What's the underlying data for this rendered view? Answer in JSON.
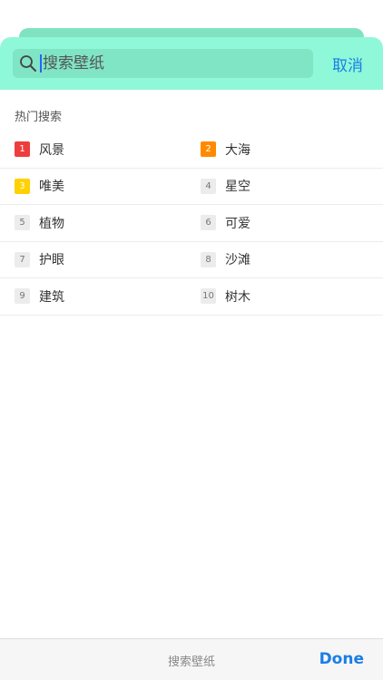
{
  "search": {
    "placeholder": "搜索壁纸",
    "cancel_label": "取消"
  },
  "hot": {
    "title": "热门搜索",
    "items": [
      {
        "rank": "1",
        "label": "风景"
      },
      {
        "rank": "2",
        "label": "大海"
      },
      {
        "rank": "3",
        "label": "唯美"
      },
      {
        "rank": "4",
        "label": "星空"
      },
      {
        "rank": "5",
        "label": "植物"
      },
      {
        "rank": "6",
        "label": "可爱"
      },
      {
        "rank": "7",
        "label": "护眼"
      },
      {
        "rank": "8",
        "label": "沙滩"
      },
      {
        "rank": "9",
        "label": "建筑"
      },
      {
        "rank": "10",
        "label": "树木"
      }
    ]
  },
  "toolbar": {
    "title": "搜索壁纸",
    "done_label": "Done"
  },
  "colors": {
    "header": "#8ff8d8",
    "accent": "#1a7ee6",
    "rank1": "#ef3d3d",
    "rank2": "#ff8a00",
    "rank3": "#ffd100"
  }
}
